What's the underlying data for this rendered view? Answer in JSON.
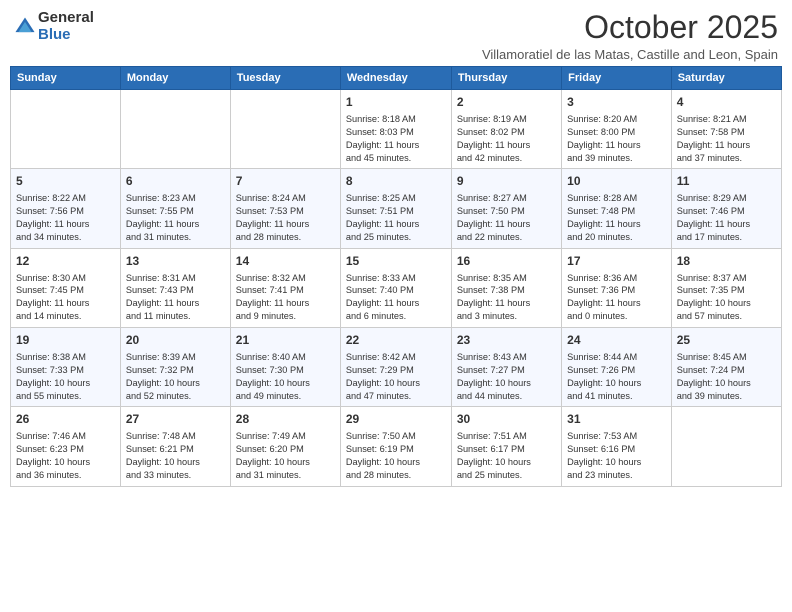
{
  "header": {
    "logo": {
      "general": "General",
      "blue": "Blue"
    },
    "title": "October 2025",
    "subtitle": "Villamoratiel de las Matas, Castille and Leon, Spain"
  },
  "columns": [
    "Sunday",
    "Monday",
    "Tuesday",
    "Wednesday",
    "Thursday",
    "Friday",
    "Saturday"
  ],
  "weeks": [
    [
      {
        "day": "",
        "info": ""
      },
      {
        "day": "",
        "info": ""
      },
      {
        "day": "",
        "info": ""
      },
      {
        "day": "1",
        "info": "Sunrise: 8:18 AM\nSunset: 8:03 PM\nDaylight: 11 hours\nand 45 minutes."
      },
      {
        "day": "2",
        "info": "Sunrise: 8:19 AM\nSunset: 8:02 PM\nDaylight: 11 hours\nand 42 minutes."
      },
      {
        "day": "3",
        "info": "Sunrise: 8:20 AM\nSunset: 8:00 PM\nDaylight: 11 hours\nand 39 minutes."
      },
      {
        "day": "4",
        "info": "Sunrise: 8:21 AM\nSunset: 7:58 PM\nDaylight: 11 hours\nand 37 minutes."
      }
    ],
    [
      {
        "day": "5",
        "info": "Sunrise: 8:22 AM\nSunset: 7:56 PM\nDaylight: 11 hours\nand 34 minutes."
      },
      {
        "day": "6",
        "info": "Sunrise: 8:23 AM\nSunset: 7:55 PM\nDaylight: 11 hours\nand 31 minutes."
      },
      {
        "day": "7",
        "info": "Sunrise: 8:24 AM\nSunset: 7:53 PM\nDaylight: 11 hours\nand 28 minutes."
      },
      {
        "day": "8",
        "info": "Sunrise: 8:25 AM\nSunset: 7:51 PM\nDaylight: 11 hours\nand 25 minutes."
      },
      {
        "day": "9",
        "info": "Sunrise: 8:27 AM\nSunset: 7:50 PM\nDaylight: 11 hours\nand 22 minutes."
      },
      {
        "day": "10",
        "info": "Sunrise: 8:28 AM\nSunset: 7:48 PM\nDaylight: 11 hours\nand 20 minutes."
      },
      {
        "day": "11",
        "info": "Sunrise: 8:29 AM\nSunset: 7:46 PM\nDaylight: 11 hours\nand 17 minutes."
      }
    ],
    [
      {
        "day": "12",
        "info": "Sunrise: 8:30 AM\nSunset: 7:45 PM\nDaylight: 11 hours\nand 14 minutes."
      },
      {
        "day": "13",
        "info": "Sunrise: 8:31 AM\nSunset: 7:43 PM\nDaylight: 11 hours\nand 11 minutes."
      },
      {
        "day": "14",
        "info": "Sunrise: 8:32 AM\nSunset: 7:41 PM\nDaylight: 11 hours\nand 9 minutes."
      },
      {
        "day": "15",
        "info": "Sunrise: 8:33 AM\nSunset: 7:40 PM\nDaylight: 11 hours\nand 6 minutes."
      },
      {
        "day": "16",
        "info": "Sunrise: 8:35 AM\nSunset: 7:38 PM\nDaylight: 11 hours\nand 3 minutes."
      },
      {
        "day": "17",
        "info": "Sunrise: 8:36 AM\nSunset: 7:36 PM\nDaylight: 11 hours\nand 0 minutes."
      },
      {
        "day": "18",
        "info": "Sunrise: 8:37 AM\nSunset: 7:35 PM\nDaylight: 10 hours\nand 57 minutes."
      }
    ],
    [
      {
        "day": "19",
        "info": "Sunrise: 8:38 AM\nSunset: 7:33 PM\nDaylight: 10 hours\nand 55 minutes."
      },
      {
        "day": "20",
        "info": "Sunrise: 8:39 AM\nSunset: 7:32 PM\nDaylight: 10 hours\nand 52 minutes."
      },
      {
        "day": "21",
        "info": "Sunrise: 8:40 AM\nSunset: 7:30 PM\nDaylight: 10 hours\nand 49 minutes."
      },
      {
        "day": "22",
        "info": "Sunrise: 8:42 AM\nSunset: 7:29 PM\nDaylight: 10 hours\nand 47 minutes."
      },
      {
        "day": "23",
        "info": "Sunrise: 8:43 AM\nSunset: 7:27 PM\nDaylight: 10 hours\nand 44 minutes."
      },
      {
        "day": "24",
        "info": "Sunrise: 8:44 AM\nSunset: 7:26 PM\nDaylight: 10 hours\nand 41 minutes."
      },
      {
        "day": "25",
        "info": "Sunrise: 8:45 AM\nSunset: 7:24 PM\nDaylight: 10 hours\nand 39 minutes."
      }
    ],
    [
      {
        "day": "26",
        "info": "Sunrise: 7:46 AM\nSunset: 6:23 PM\nDaylight: 10 hours\nand 36 minutes."
      },
      {
        "day": "27",
        "info": "Sunrise: 7:48 AM\nSunset: 6:21 PM\nDaylight: 10 hours\nand 33 minutes."
      },
      {
        "day": "28",
        "info": "Sunrise: 7:49 AM\nSunset: 6:20 PM\nDaylight: 10 hours\nand 31 minutes."
      },
      {
        "day": "29",
        "info": "Sunrise: 7:50 AM\nSunset: 6:19 PM\nDaylight: 10 hours\nand 28 minutes."
      },
      {
        "day": "30",
        "info": "Sunrise: 7:51 AM\nSunset: 6:17 PM\nDaylight: 10 hours\nand 25 minutes."
      },
      {
        "day": "31",
        "info": "Sunrise: 7:53 AM\nSunset: 6:16 PM\nDaylight: 10 hours\nand 23 minutes."
      },
      {
        "day": "",
        "info": ""
      }
    ]
  ]
}
